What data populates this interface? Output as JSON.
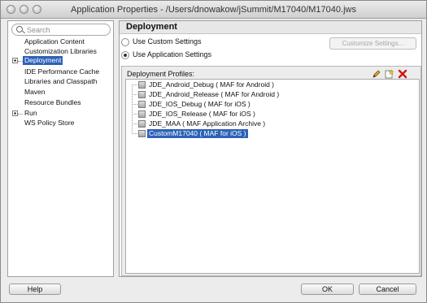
{
  "window": {
    "title": "Application Properties - /Users/dnowakow/jSummit/M17040/M17040.jws"
  },
  "sidebar": {
    "search_placeholder": "Search",
    "items": [
      {
        "label": "Application Content"
      },
      {
        "label": "Customization Libraries"
      },
      {
        "label": "Deployment",
        "selected": true
      },
      {
        "label": "IDE Performance Cache"
      },
      {
        "label": "Libraries and Classpath"
      },
      {
        "label": "Maven"
      },
      {
        "label": "Resource Bundles"
      },
      {
        "label": "Run"
      },
      {
        "label": "WS Policy Store"
      }
    ]
  },
  "main": {
    "heading": "Deployment",
    "use_custom_label": "Use Custom Settings",
    "use_app_label": "Use Application Settings",
    "customize_label": "Customize Settings...",
    "profiles_label": "Deployment Profiles:",
    "profiles": [
      {
        "label": "JDE_Android_Debug ( MAF for Android )"
      },
      {
        "label": "JDE_Android_Release ( MAF for Android )"
      },
      {
        "label": "JDE_IOS_Debug ( MAF for iOS )"
      },
      {
        "label": "JDE_IOS_Release ( MAF for iOS )"
      },
      {
        "label": "JDE_MAA ( MAF Application Archive )"
      },
      {
        "label": "CustomM17040 ( MAF for iOS )",
        "selected": true
      }
    ]
  },
  "footer": {
    "help_label": "Help",
    "ok_label": "OK",
    "cancel_label": "Cancel"
  },
  "colors": {
    "selection": "#2d62b7",
    "delete_icon": "#d01515",
    "pencil_icon": "#d6a72b"
  }
}
